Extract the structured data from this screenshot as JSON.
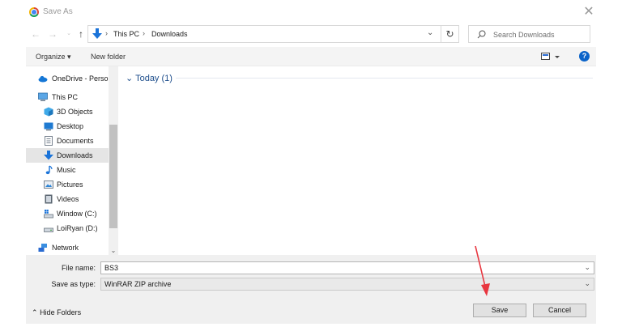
{
  "window": {
    "title": "Save As"
  },
  "navigation": {
    "breadcrumbs": [
      "This PC",
      "Downloads"
    ],
    "search_placeholder": "Search Downloads"
  },
  "toolbar": {
    "organize_label": "Organize",
    "new_folder_label": "New folder",
    "help_label": "?"
  },
  "sidebar": {
    "items": [
      {
        "label": "OneDrive - Persor",
        "icon": "cloud-icon"
      },
      {
        "label": "This PC",
        "icon": "computer-icon"
      },
      {
        "label": "3D Objects",
        "icon": "cube-icon"
      },
      {
        "label": "Desktop",
        "icon": "desktop-icon"
      },
      {
        "label": "Documents",
        "icon": "document-icon"
      },
      {
        "label": "Downloads",
        "icon": "download-icon",
        "selected": true
      },
      {
        "label": "Music",
        "icon": "music-icon"
      },
      {
        "label": "Pictures",
        "icon": "pictures-icon"
      },
      {
        "label": "Videos",
        "icon": "videos-icon"
      },
      {
        "label": "Window (C:)",
        "icon": "drive-icon"
      },
      {
        "label": "LoiRyan (D:)",
        "icon": "drive-icon"
      },
      {
        "label": "Network",
        "icon": "network-icon"
      }
    ]
  },
  "content": {
    "groups": [
      {
        "header": "Today (1)"
      }
    ]
  },
  "form": {
    "file_name_label": "File name:",
    "file_name_value": "BS3",
    "save_as_type_label": "Save as type:",
    "save_as_type_value": "WinRAR ZIP archive",
    "hide_folders_label": "Hide Folders",
    "save_label": "Save",
    "cancel_label": "Cancel"
  },
  "colors": {
    "accent": "#0a63c9",
    "annotation_arrow": "#e8363f",
    "group_header": "#1e4e8c"
  }
}
